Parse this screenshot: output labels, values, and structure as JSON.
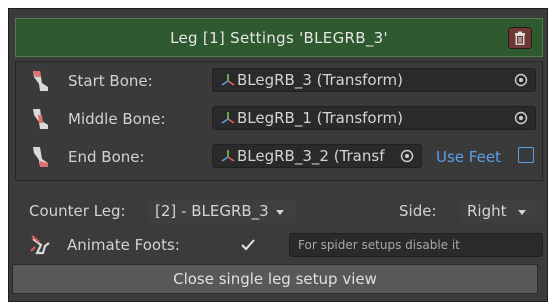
{
  "header": {
    "title": "Leg  [1]  Settings  'BLEGRB_3'",
    "delete_icon": "trash-icon"
  },
  "bones": [
    {
      "label": "Start Bone:",
      "value": "BLegRB_3 (Transform)"
    },
    {
      "label": "Middle Bone:",
      "value": "BLegRB_1 (Transform)"
    },
    {
      "label": "End Bone:",
      "value": "BLegRB_3_2 (Transf"
    }
  ],
  "use_feet": {
    "label": "Use Feet",
    "checked": false
  },
  "counter_leg": {
    "label": "Counter Leg:",
    "value": "[2] - BLEGRB_3"
  },
  "side": {
    "label": "Side:",
    "value": "Right"
  },
  "animate_foots": {
    "label": "Animate Foots:",
    "checked": true,
    "hint": "For spider setups disable it"
  },
  "close_button": {
    "label": "Close single leg setup view"
  },
  "colors": {
    "header_bg": "#2f5a2f",
    "accent": "#5a9ee8",
    "panel_bg": "#3b3b3b",
    "delete_bg": "#6b3a34"
  }
}
